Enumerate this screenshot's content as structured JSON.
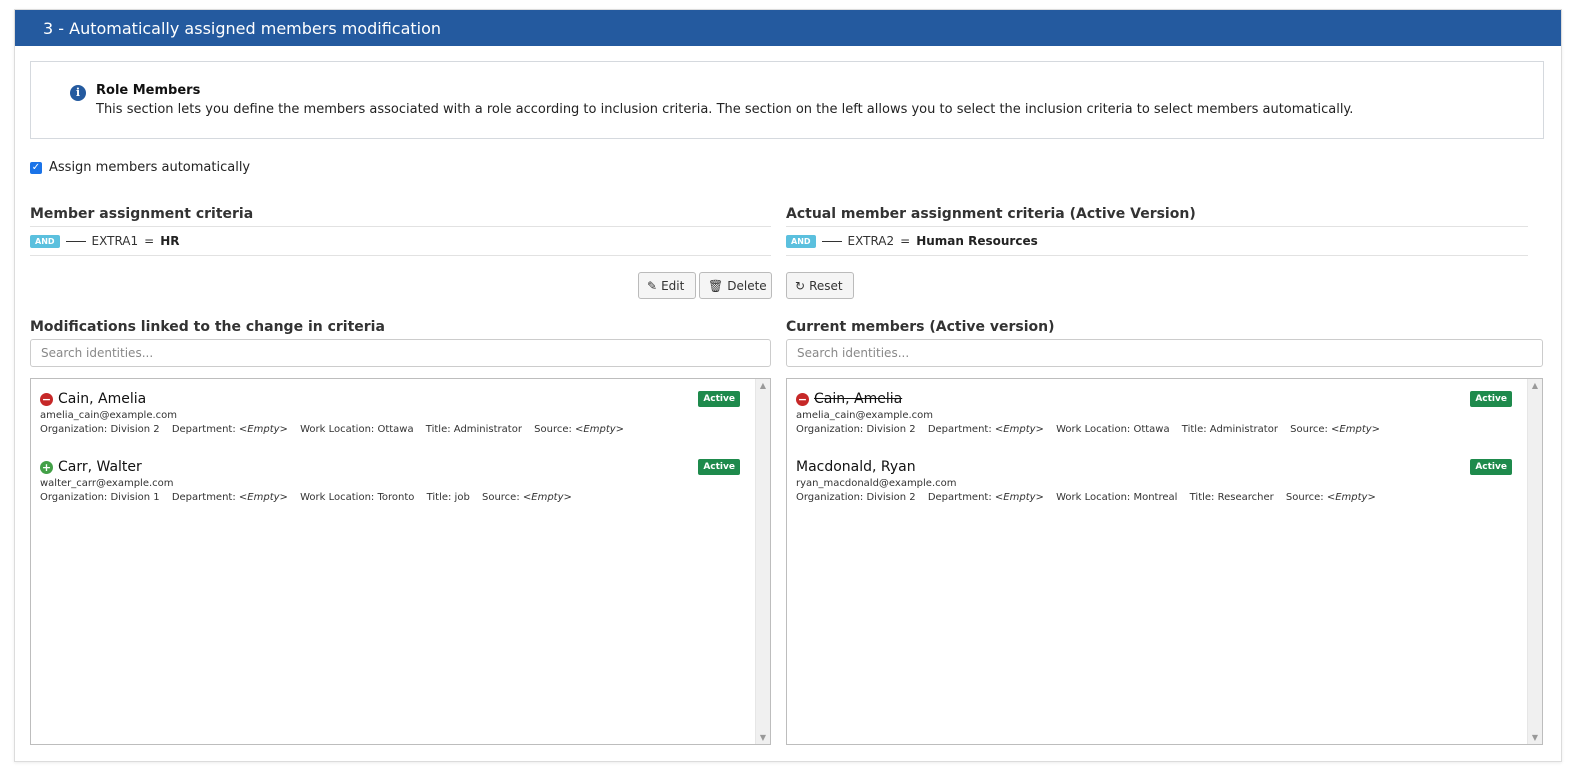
{
  "panel": {
    "title": "3 - Automatically assigned members modification"
  },
  "info": {
    "title": "Role Members",
    "text": "This section lets you define the members associated with a role according to inclusion criteria. The section on the left allows you to select the inclusion criteria to select members automatically."
  },
  "auto_assign": {
    "label": "Assign members automatically",
    "checked": true
  },
  "left": {
    "criteria_title": "Member assignment criteria",
    "criteria": {
      "operator": "AND",
      "field": "EXTRA1",
      "equals": "=",
      "value": "HR"
    },
    "edit_label": "Edit",
    "delete_label": "Delete",
    "list_title": "Modifications linked to the change in criteria",
    "search_placeholder": "Search identities...",
    "members": [
      {
        "name": "Cain, Amelia",
        "status": "remove",
        "badge": "Active",
        "email": "amelia_cain@example.com",
        "organization": "Organization: Division 2",
        "department_label": "Department:",
        "department": "<Empty>",
        "location": "Work Location: Ottawa",
        "title": "Title: Administrator",
        "source_label": "Source:",
        "source": "<Empty>"
      },
      {
        "name": "Carr, Walter",
        "status": "add",
        "badge": "Active",
        "email": "walter_carr@example.com",
        "organization": "Organization: Division 1",
        "department_label": "Department:",
        "department": "<Empty>",
        "location": "Work Location: Toronto",
        "title": "Title: job",
        "source_label": "Source:",
        "source": "<Empty>"
      }
    ]
  },
  "right": {
    "criteria_title": "Actual member assignment criteria (Active Version)",
    "criteria": {
      "operator": "AND",
      "field": "EXTRA2",
      "equals": "=",
      "value": "Human Resources"
    },
    "reset_label": "Reset",
    "list_title": "Current members (Active version)",
    "search_placeholder": "Search identities...",
    "members": [
      {
        "name": "Cain, Amelia",
        "status": "remove",
        "badge": "Active",
        "email": "amelia_cain@example.com",
        "organization": "Organization: Division 2",
        "department_label": "Department:",
        "department": "<Empty>",
        "location": "Work Location: Ottawa",
        "title": "Title: Administrator",
        "source_label": "Source:",
        "source": "<Empty>"
      },
      {
        "name": "Macdonald, Ryan",
        "status": "none",
        "badge": "Active",
        "email": "ryan_macdonald@example.com",
        "organization": "Organization: Division 2",
        "department_label": "Department:",
        "department": "<Empty>",
        "location": "Work Location: Montreal",
        "title": "Title: Researcher",
        "source_label": "Source:",
        "source": "<Empty>"
      }
    ]
  },
  "icons": {
    "info": "info-icon",
    "edit": "edit-icon",
    "delete": "trash-icon",
    "reset": "reset-icon",
    "remove": "minus-circle-icon",
    "add": "plus-circle-icon"
  },
  "colors": {
    "header": "#245a9f",
    "active_badge": "#1e8a4c",
    "remove": "#c62828",
    "add": "#43a047",
    "and_badge": "#5bc0de"
  }
}
